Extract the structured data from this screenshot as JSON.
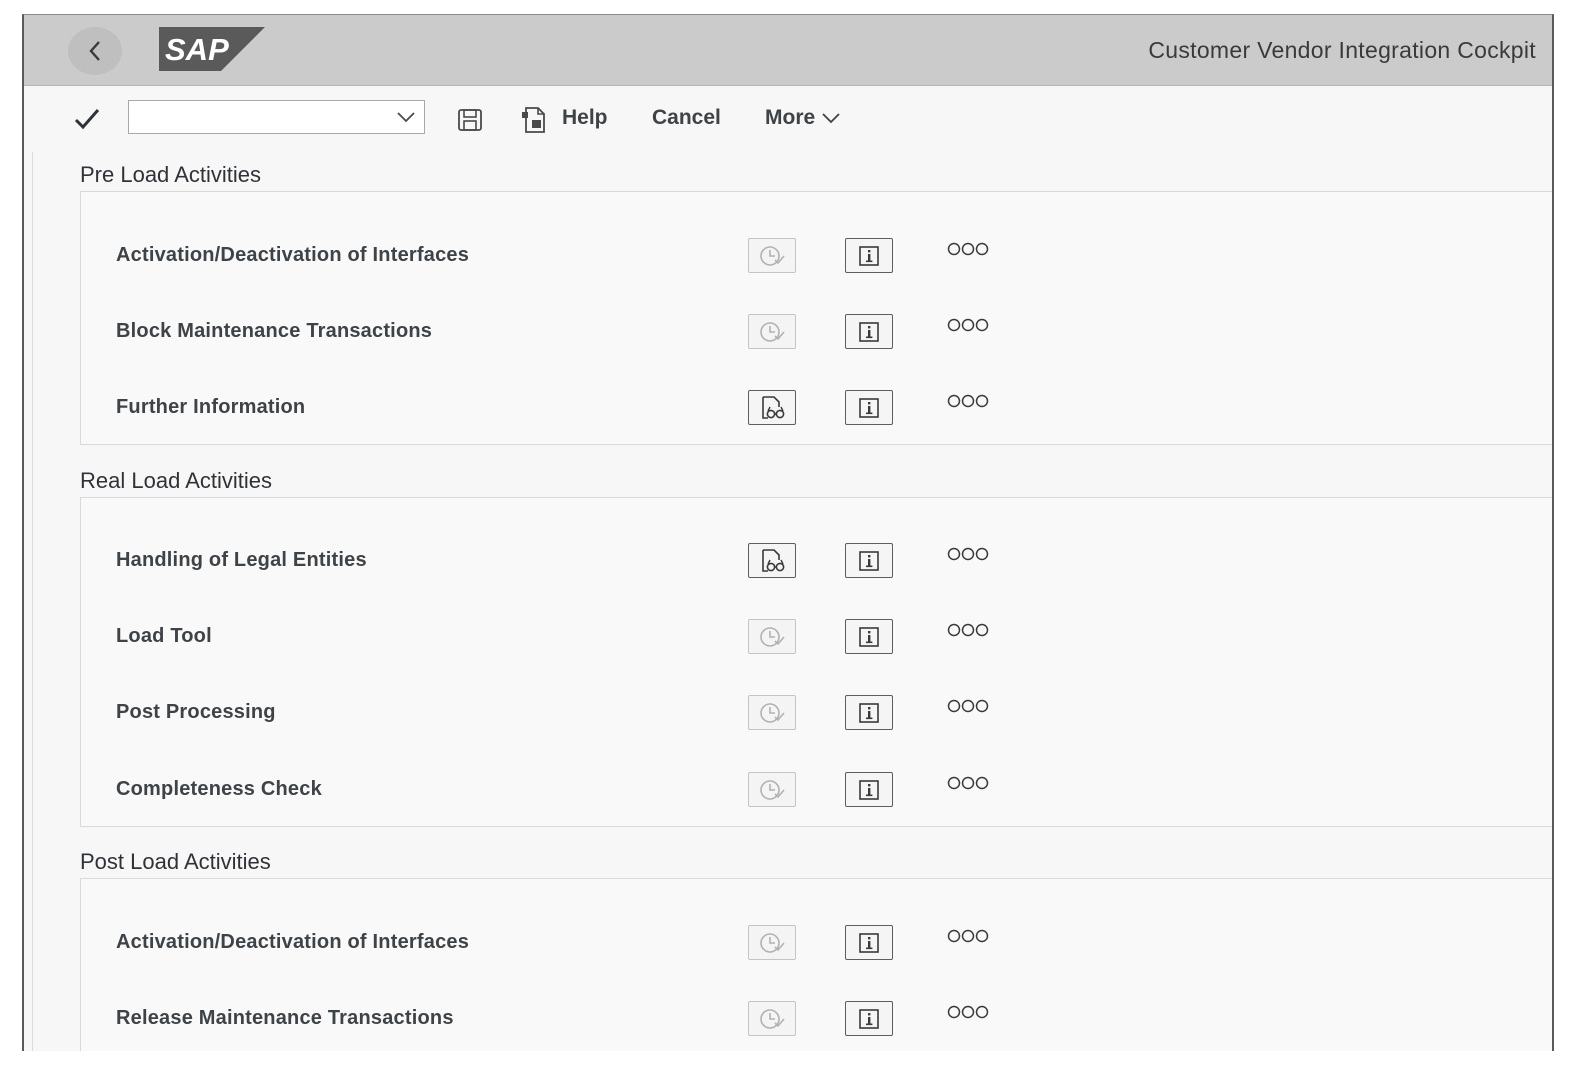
{
  "shell": {
    "title": "Customer Vendor Integration Cockpit",
    "logo_text": "SAP"
  },
  "toolbar": {
    "combo_value": "",
    "help_label": "Help",
    "cancel_label": "Cancel",
    "more_label": "More"
  },
  "sections": [
    {
      "title": "Pre Load Activities",
      "rows": [
        {
          "label": "Activation/Deactivation of Interfaces",
          "action": "clock",
          "enabled": false,
          "status": "OOO"
        },
        {
          "label": "Block Maintenance Transactions",
          "action": "clock",
          "enabled": false,
          "status": "OOO"
        },
        {
          "label": "Further Information",
          "action": "document-glasses",
          "enabled": true,
          "status": "OOO"
        }
      ]
    },
    {
      "title": "Real Load Activities",
      "rows": [
        {
          "label": "Handling of Legal Entities",
          "action": "document-glasses",
          "enabled": true,
          "status": "OOO"
        },
        {
          "label": "Load Tool",
          "action": "clock",
          "enabled": false,
          "status": "OOO"
        },
        {
          "label": "Post Processing",
          "action": "clock",
          "enabled": false,
          "status": "OOO"
        },
        {
          "label": "Completeness Check",
          "action": "clock",
          "enabled": false,
          "status": "OOO"
        }
      ]
    },
    {
      "title": "Post Load Activities",
      "rows": [
        {
          "label": "Activation/Deactivation of Interfaces",
          "action": "clock",
          "enabled": false,
          "status": "OOO"
        },
        {
          "label": "Release Maintenance Transactions",
          "action": "clock",
          "enabled": false,
          "status": "OOO"
        }
      ]
    }
  ],
  "colors": {
    "shell_bg": "#cbcbcb",
    "page_bg": "#f7f7f7",
    "text": "#3e4348"
  }
}
